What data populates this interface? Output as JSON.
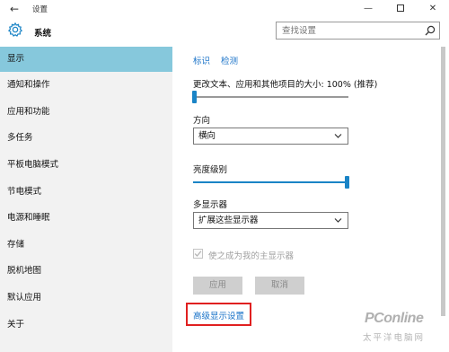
{
  "window": {
    "title": "设置",
    "back_glyph": "←",
    "min_glyph": "—",
    "close_glyph": "✕"
  },
  "header": {
    "section_title": "系统",
    "search_placeholder": "查找设置"
  },
  "sidebar": {
    "items": [
      {
        "label": "显示",
        "active": true
      },
      {
        "label": "通知和操作"
      },
      {
        "label": "应用和功能"
      },
      {
        "label": "多任务"
      },
      {
        "label": "平板电脑模式"
      },
      {
        "label": "节电模式"
      },
      {
        "label": "电源和睡眠"
      },
      {
        "label": "存储"
      },
      {
        "label": "脱机地图"
      },
      {
        "label": "默认应用"
      },
      {
        "label": "关于"
      }
    ]
  },
  "main": {
    "identify_link": "标识",
    "detect_link": "检测",
    "scale_label": "更改文本、应用和其他项目的大小: 100% (推荐)",
    "scale_value_percent": 100,
    "orientation_label": "方向",
    "orientation_value": "横向",
    "brightness_label": "亮度级别",
    "brightness_level": 1.0,
    "multi_display_label": "多显示器",
    "multi_display_value": "扩展这些显示器",
    "main_display_checkbox": "使之成为我的主显示器",
    "main_display_checked": true,
    "apply_button": "应用",
    "cancel_button": "取消",
    "advanced_link": "高级显示设置"
  },
  "watermark": {
    "brand": "PConline",
    "subtitle": "太平洋电脑网"
  },
  "colors": {
    "accent": "#1a84c6",
    "sidebar_bg": "#f2f2f2",
    "sidebar_active": "#86c8dc",
    "highlight_box": "#e02020"
  }
}
